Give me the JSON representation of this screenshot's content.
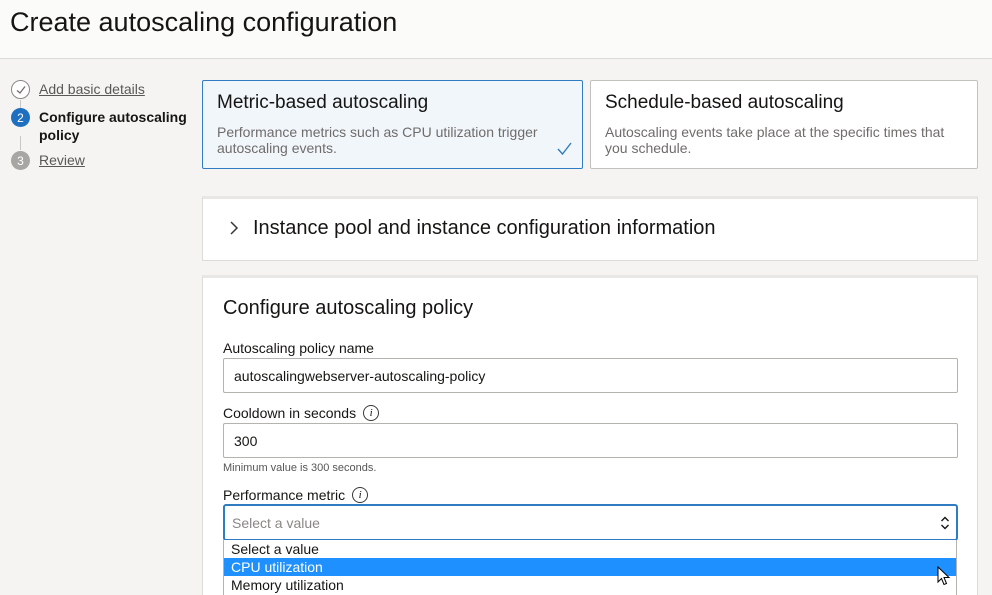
{
  "page": {
    "title": "Create autoscaling configuration"
  },
  "steps": [
    {
      "marker": "",
      "label": "Add basic details",
      "state": "done"
    },
    {
      "marker": "2",
      "label": "Configure autoscaling policy",
      "state": "active"
    },
    {
      "marker": "3",
      "label": "Review",
      "state": "todo"
    }
  ],
  "autoscaling_types": [
    {
      "title": "Metric-based autoscaling",
      "description": "Performance metrics such as CPU utilization trigger autoscaling events.",
      "selected": true
    },
    {
      "title": "Schedule-based autoscaling",
      "description": "Autoscaling events take place at the specific times that you schedule.",
      "selected": false
    }
  ],
  "accordion": {
    "title": "Instance pool and instance configuration information",
    "expanded": false
  },
  "policy": {
    "section_title": "Configure autoscaling policy",
    "name_label": "Autoscaling policy name",
    "name_value": "autoscalingwebserver-autoscaling-policy",
    "cooldown_label": "Cooldown in seconds",
    "cooldown_value": "300",
    "cooldown_hint": "Minimum value is 300 seconds.",
    "metric_label": "Performance metric",
    "metric_placeholder": "Select a value",
    "metric_options": [
      "Select a value",
      "CPU utilization",
      "Memory utilization"
    ],
    "highlighted_option": "CPU utilization"
  },
  "colors": {
    "accent": "#2f7cc2",
    "highlight": "#1e90ff",
    "selected_card_bg": "#f1f6fb"
  }
}
